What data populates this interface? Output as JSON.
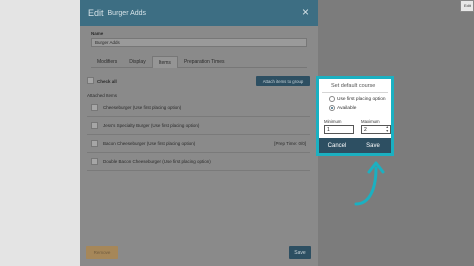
{
  "background": {
    "edit_button_label": "Edit"
  },
  "modal": {
    "title_prefix": "Edit",
    "title": "Burger Adds",
    "close_icon": "×",
    "name_label": "Name",
    "name_value": "Burger Adds",
    "tabs": [
      {
        "label": "Modifiers"
      },
      {
        "label": "Display"
      },
      {
        "label": "Items"
      },
      {
        "label": "Preparation Times"
      }
    ],
    "active_tab": "Items",
    "check_all_label": "Check all",
    "attach_button_label": "Attach items to group",
    "attached_items_label": "Attached Items",
    "items": [
      {
        "name": "Cheeseburger (Use first placing option)",
        "tag": ""
      },
      {
        "name": "Jess's Specialty Burger (Use first placing option)",
        "tag": ""
      },
      {
        "name": "Bacon Cheeseburger (Use first placing option)",
        "tag": "[Prep Time: 0/0]"
      },
      {
        "name": "Double Bacon Cheeseburger (Use first placing option)",
        "tag": ""
      }
    ],
    "remove_button_label": "Remove",
    "save_button_label": "Save"
  },
  "popover": {
    "title": "Set default course",
    "options": [
      {
        "label": "Use first placing option",
        "selected": false
      },
      {
        "label": "Available",
        "selected": true
      }
    ],
    "minimum_label": "Minimum",
    "minimum_value": "1",
    "maximum_label": "Maximum",
    "maximum_value": "2",
    "cancel_label": "Cancel",
    "save_label": "Save"
  },
  "colors": {
    "highlight": "#1bb0c1",
    "header": "#3d6e83",
    "primary_button": "#2d4f62"
  },
  "icons": [
    "close-icon",
    "checkbox-icon",
    "radio-icon",
    "spinner-icon",
    "curved-arrow-icon"
  ]
}
